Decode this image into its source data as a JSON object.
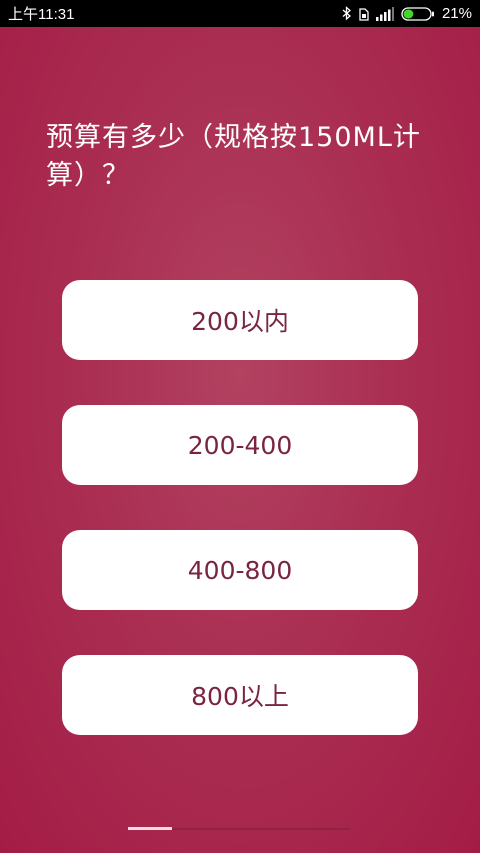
{
  "status_bar": {
    "time": "上午11:31",
    "battery_percent": "21%",
    "battery_level": 0.21,
    "icons": [
      "bluetooth-icon",
      "sim-icon",
      "signal-icon",
      "battery-icon"
    ]
  },
  "question": {
    "text": "预算有多少（规格按150ML计算）？"
  },
  "options": [
    {
      "label": "200以内"
    },
    {
      "label": "200-400"
    },
    {
      "label": "400-800"
    },
    {
      "label": "800以上"
    }
  ],
  "progress": {
    "fraction": 0.2
  },
  "colors": {
    "background": "#aa2f52",
    "option_text": "#7a2444",
    "option_bg": "#ffffff",
    "battery_fill": "#44d62c"
  }
}
